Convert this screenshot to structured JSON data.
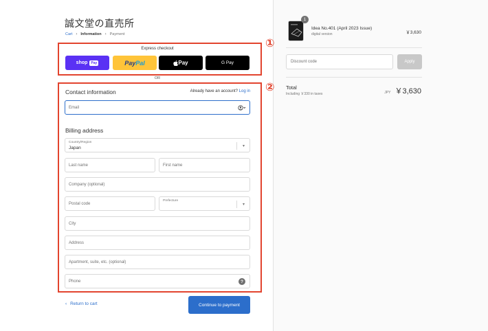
{
  "shop": {
    "title": "誠文堂の直売所"
  },
  "breadcrumb": {
    "cart": "Cart",
    "information": "Information",
    "payment": "Payment",
    "separator": "›"
  },
  "annotations": {
    "marker_1": "①",
    "marker_2": "②",
    "color": "#e2432d"
  },
  "express": {
    "label": "Express checkout",
    "shop_pay": {
      "text": "shop",
      "badge": "Pay"
    },
    "paypal": {
      "pay": "Pay",
      "pal": "Pal"
    },
    "apple_pay": {
      "text": " Pay"
    },
    "google_pay": {
      "text": "G Pay"
    },
    "or": "OR"
  },
  "contact": {
    "title": "Contact information",
    "account_prompt": "Already have an account?",
    "login_link": "Log in",
    "email_placeholder": "Email"
  },
  "billing": {
    "title": "Billing address",
    "country_label": "Country/Region",
    "country_value": "Japan",
    "last_name": "Last name",
    "first_name": "First name",
    "company": "Company (optional)",
    "postal_code": "Postal code",
    "prefecture": "Prefecture",
    "city": "City",
    "address": "Address",
    "apartment": "Apartment, suite, etc. (optional)",
    "phone": "Phone"
  },
  "actions": {
    "return_label": "Return to cart",
    "continue_label": "Continue to payment"
  },
  "summary": {
    "quantity": "1",
    "product_name": "Idea No.401 (April 2023 Issue)",
    "product_variant": "digital version",
    "product_price": "￥3,630",
    "discount_placeholder": "Discount code",
    "apply_label": "Apply",
    "total_label": "Total",
    "tax_text": "Including ￥330 in taxes",
    "currency": "JPY",
    "total_amount": "￥3,630"
  },
  "colors": {
    "accent": "#2c6ecb",
    "shop_pay": "#5a31f4",
    "paypal": "#ffc439"
  }
}
